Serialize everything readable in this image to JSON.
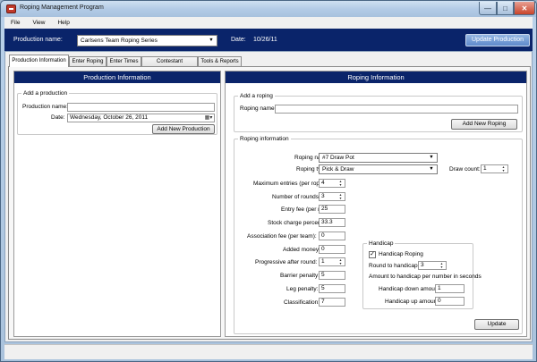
{
  "window": {
    "title": "Roping Management Program"
  },
  "menu": [
    "File",
    "View",
    "Help"
  ],
  "production_bar": {
    "label": "Production name:",
    "selected": "Carlsens Team Roping Series",
    "date_label": "Date:",
    "date_value": "10/26/11",
    "update_button": "Update Production"
  },
  "tabs": [
    "Production Information",
    "Enter Roping",
    "Enter Times",
    "Contestant Information",
    "Tools & Reports"
  ],
  "production_panel": {
    "header": "Production Information",
    "group_title": "Add a production",
    "name_label": "Production name:",
    "name_value": "",
    "date_label": "Date:",
    "date_value": "Wednesday,   October   26, 2011",
    "add_button": "Add New Production"
  },
  "roping_panel": {
    "header": "Roping Information",
    "add_group_title": "Add a roping",
    "add_name_label": "Roping name:",
    "add_name_value": "",
    "add_button": "Add New Roping",
    "info_group_title": "Roping information",
    "fields": {
      "roping_name_label": "Roping name:",
      "roping_name_value": "#7 Draw Pot",
      "roping_type_label": "Roping type:",
      "roping_type_value": "Pick & Draw",
      "draw_count_label": "Draw count:",
      "draw_count_value": "1",
      "max_entries_label": "Maximum entries (per roper):",
      "max_entries_value": "4",
      "num_rounds_label": "Number of rounds:",
      "num_rounds_value": "3",
      "entry_fee_label": "Entry fee (per roper):",
      "entry_fee_value": "25",
      "stock_charge_label": "Stock charge percent:",
      "stock_charge_value": "33.3",
      "association_fee_label": "Association fee (per team):",
      "association_fee_value": "0",
      "added_money_label": "Added money:",
      "added_money_value": "0",
      "progressive_label": "Progressive after round:",
      "progressive_value": "1",
      "barrier_label": "Barrier penalty:",
      "barrier_value": "5",
      "leg_label": "Leg penalty:",
      "leg_value": "5",
      "classification_label": "Classification:",
      "classification_value": "7"
    },
    "handicap": {
      "title": "Handicap",
      "checkbox_label": "Handicap Roping",
      "checked": true,
      "round_label": "Round to handicap:",
      "round_value": "3",
      "amount_label": "Amount to handicap per number in seconds",
      "down_label": "Handicap down amount:",
      "down_value": "1",
      "up_label": "Handicap up amount:",
      "up_value": "0"
    },
    "update_button": "Update"
  }
}
